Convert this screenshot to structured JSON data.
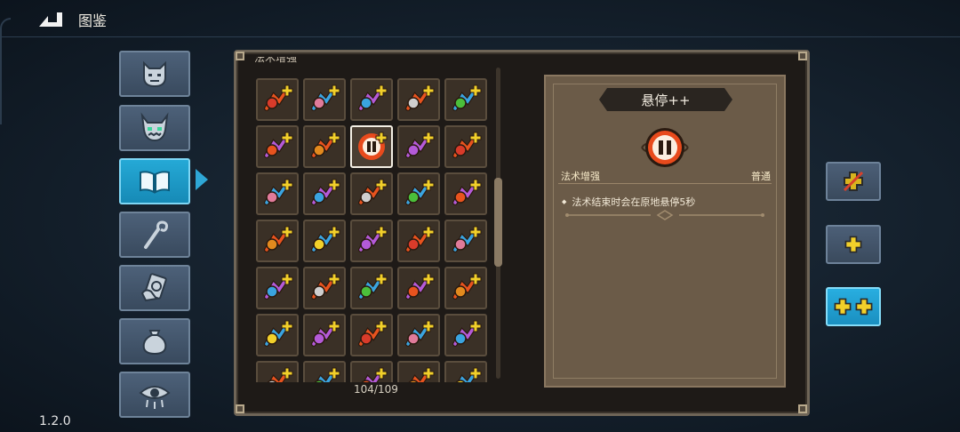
{
  "header": {
    "title": "图鉴",
    "back_icon": "back-arrow-icon"
  },
  "version": "1.2.0",
  "side_tabs": [
    {
      "icon": "demon-face-icon",
      "active": false
    },
    {
      "icon": "horned-monster-icon",
      "active": false
    },
    {
      "icon": "open-book-icon",
      "active": true
    },
    {
      "icon": "staff-icon",
      "active": false
    },
    {
      "icon": "hand-card-icon",
      "active": false
    },
    {
      "icon": "pouch-icon",
      "active": false
    },
    {
      "icon": "eye-icon",
      "active": false
    }
  ],
  "grid": {
    "section_title": "法术增强",
    "count_label": "104/109",
    "selected_index": 7,
    "items": [
      "triple-arrow-icon",
      "double-arrow-icon",
      "fan-arrow-icon",
      "cloud-burst-icon",
      "green-drop-icon",
      "orbit-arrow-icon",
      "lightning-icon",
      "pause-icon",
      "crescent-icon",
      "mouse-icon",
      "target-icon",
      "zigzag-arrow-icon",
      "split-arrow-icon",
      "blue-crystal-icon",
      "worm-icon",
      "bolt-fork-icon",
      "up-arrows-icon",
      "orb-cross-icon",
      "battery-icon",
      "square-burst-icon",
      "chevron-right-icon",
      "sun-icon",
      "potion-icon",
      "cube-icon",
      "tentacle-icon",
      "flame-eye-icon",
      "sigma-icon",
      "shuriken-icon",
      "hook-icon",
      "vortex-icon",
      "tower-icon",
      "bug-icon",
      "fire-sword-icon",
      "claw-icon",
      "gem-icon"
    ]
  },
  "detail": {
    "title": "悬停++",
    "icon": "pause-icon",
    "category": "法术增强",
    "rarity": "普通",
    "description": "法术结束时会在原地悬停5秒"
  },
  "levels": [
    {
      "icon": "disabled-plus-icon",
      "active": false
    },
    {
      "icon": "plus-icon",
      "active": false
    },
    {
      "icon": "double-plus-icon",
      "active": true
    }
  ],
  "colors": {
    "accent_blue": "#1f9fd1",
    "panel_brown": "#6b5b48",
    "gold": "#f2d02a",
    "orange": "#e8531e"
  }
}
